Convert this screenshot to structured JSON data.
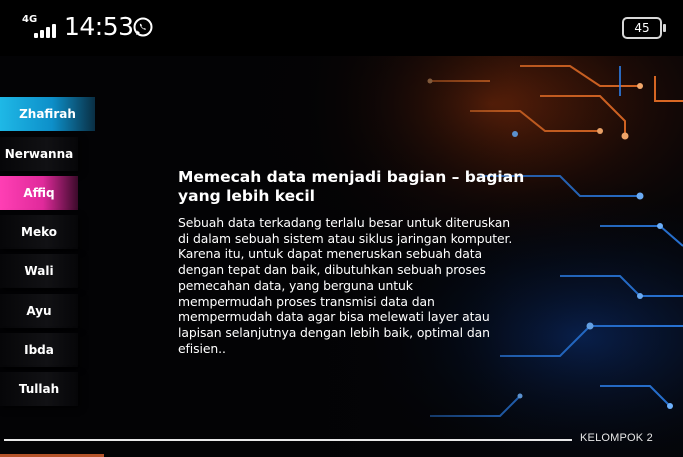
{
  "status_bar": {
    "network": "4G",
    "time": "14:53",
    "notification_icon": "whatsapp-icon",
    "battery_level": "45"
  },
  "members": [
    {
      "name": "Zhafirah",
      "style": "cyan"
    },
    {
      "name": "Nerwanna",
      "style": "plain"
    },
    {
      "name": "Affiq",
      "style": "pink"
    },
    {
      "name": "Meko",
      "style": "plain"
    },
    {
      "name": "Wali",
      "style": "plain"
    },
    {
      "name": "Ayu",
      "style": "plain"
    },
    {
      "name": "Ibda",
      "style": "plain"
    },
    {
      "name": "Tullah",
      "style": "plain"
    }
  ],
  "content": {
    "heading_line1": "Memecah data menjadi bagian – bagian",
    "heading_line2": "yang lebih kecil",
    "body_lines": [
      "Sebuah data terkadang terlalu besar untuk diteruskan",
      "di dalam sebuah sistem atau siklus jaringan komputer.",
      "Karena itu, untuk dapat meneruskan sebuah data",
      "dengan tepat dan baik, dibutuhkan sebuah proses",
      "pemecahan data, yang berguna untuk",
      "mempermudah proses transmisi data dan",
      "mempermudah data agar bisa melewati layer atau",
      "lapisan selanjutnya dengan lebih baik, optimal dan",
      "efisien.."
    ]
  },
  "footer": {
    "label": "KELOMPOK 2"
  },
  "colors": {
    "accent_cyan": "#1fb8e6",
    "accent_pink": "#ff3fb4",
    "circuit_orange": "#ff7a2a",
    "circuit_blue": "#2f8bff"
  }
}
